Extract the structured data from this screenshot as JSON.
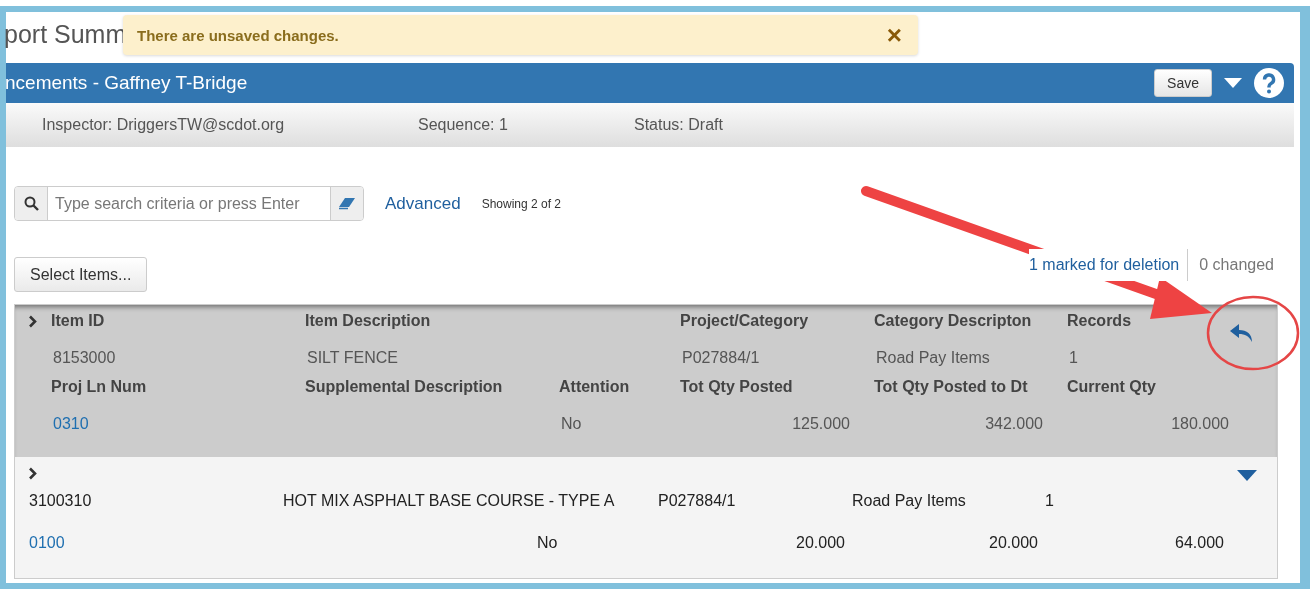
{
  "page_title": "port Summ",
  "toast": {
    "message": "There are unsaved changes.",
    "close": "×"
  },
  "header": {
    "title": "ncements - Gaffney T-Bridge",
    "save": "Save"
  },
  "info": [
    "Inspector: DriggersTW@scdot.org",
    "Sequence: 1",
    "Status: Draft"
  ],
  "search": {
    "placeholder": "Type search criteria or press Enter",
    "advanced": "Advanced",
    "showing": "Showing 2 of 2"
  },
  "select_items": "Select Items...",
  "summary": {
    "deleted": "1 marked for deletion",
    "changed": "0 changed"
  },
  "rows": [
    {
      "marked_for_deletion": true,
      "expanded": true,
      "line_1": [
        {
          "label": "Item ID",
          "value": "8153000"
        },
        {
          "label": "Item Description",
          "value": "SILT FENCE"
        },
        {
          "label": "Project/Category",
          "value": "P027884/1",
          "after_gap": true
        },
        {
          "label": "Category Descripton",
          "value": "Road Pay Items"
        },
        {
          "label": "Records",
          "value": "1"
        }
      ],
      "line_2": [
        {
          "label": "Proj Ln Num",
          "value": "0310",
          "kind": "link"
        },
        {
          "label": "Supplemental Description"
        },
        {
          "label": "Attention",
          "value": "No"
        },
        {
          "label": "Tot Qty Posted",
          "value": "125.000",
          "kind": "number"
        },
        {
          "label": "Tot Qty Posted to Dt",
          "value": "342.000",
          "kind": "number"
        },
        {
          "label": "Current Qty",
          "value": "180.000",
          "kind": "number"
        }
      ]
    },
    {
      "marked_for_deletion": false,
      "expanded": false,
      "line_1": [
        {
          "value": "3100310"
        },
        {
          "value": "HOT MIX ASPHALT BASE COURSE - TYPE A"
        },
        {
          "value": "P027884/1",
          "after_gap": true
        },
        {
          "value": "Road Pay Items"
        },
        {
          "value": "1"
        }
      ],
      "line_2": [
        {
          "value": "0100",
          "kind": "link"
        },
        {
          "value": "No",
          "after_gap": true
        },
        {
          "value": "20.000",
          "kind": "number"
        },
        {
          "value": "20.000",
          "kind": "number"
        },
        {
          "value": "64.000",
          "kind": "number"
        }
      ]
    }
  ]
}
